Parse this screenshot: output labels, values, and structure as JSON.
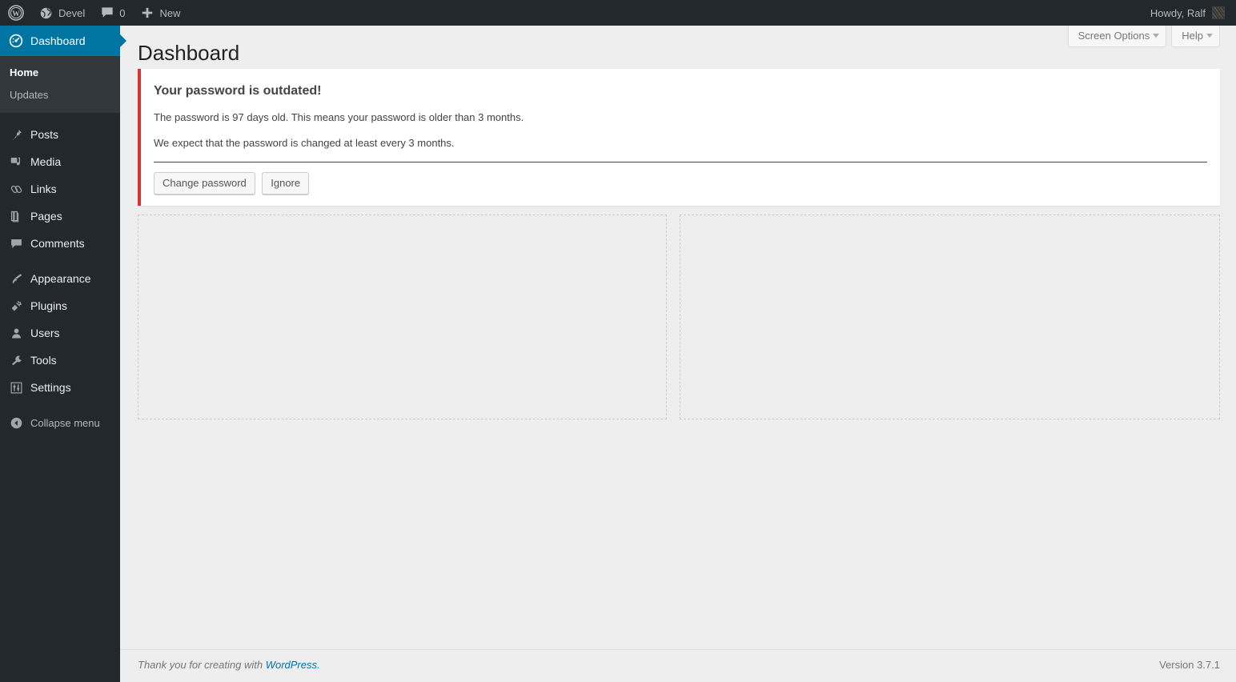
{
  "adminbar": {
    "wp_logo_label": "WordPress",
    "site_name": "Devel",
    "comments_count": "0",
    "new_label": "New",
    "howdy": "Howdy, Ralf"
  },
  "sidebar": {
    "items": [
      {
        "label": "Dashboard",
        "icon": "dashboard-icon",
        "current": true
      },
      {
        "label": "Posts",
        "icon": "pin-icon",
        "current": false
      },
      {
        "label": "Media",
        "icon": "media-icon",
        "current": false
      },
      {
        "label": "Links",
        "icon": "link-icon",
        "current": false
      },
      {
        "label": "Pages",
        "icon": "page-icon",
        "current": false
      },
      {
        "label": "Comments",
        "icon": "comment-icon",
        "current": false
      },
      {
        "label": "Appearance",
        "icon": "brush-icon",
        "current": false
      },
      {
        "label": "Plugins",
        "icon": "plugin-icon",
        "current": false
      },
      {
        "label": "Users",
        "icon": "user-icon",
        "current": false
      },
      {
        "label": "Tools",
        "icon": "wrench-icon",
        "current": false
      },
      {
        "label": "Settings",
        "icon": "settings-icon",
        "current": false
      }
    ],
    "submenu": [
      {
        "label": "Home",
        "current": true
      },
      {
        "label": "Updates",
        "current": false
      }
    ],
    "collapse_label": "Collapse menu"
  },
  "screen_meta": {
    "screen_options": "Screen Options",
    "help": "Help"
  },
  "page": {
    "title": "Dashboard"
  },
  "notice": {
    "heading": "Your password is outdated!",
    "line1": "The password is 97 days old. This means your password is older than 3 months.",
    "line2": "We expect that the password is changed at least every 3 months.",
    "primary_button": "Change password",
    "secondary_button": "Ignore",
    "accent_color": "#dc3232"
  },
  "footer": {
    "thanks_prefix": "Thank you for creating with ",
    "wordpress_link": "WordPress.",
    "version": "Version 3.7.1"
  }
}
